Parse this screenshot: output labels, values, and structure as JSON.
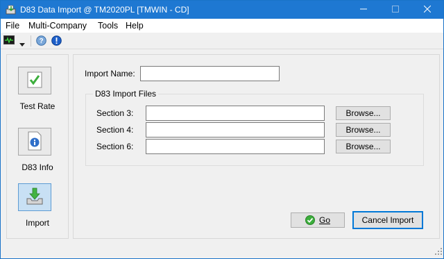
{
  "window": {
    "title": "D83 Data Import @ TM2020PL [TMWIN - CD]",
    "title_bar_color": "#1e78d2"
  },
  "menu": {
    "items": [
      "File",
      "Multi-Company",
      "Tools",
      "Help"
    ]
  },
  "toolbar": {
    "icons": [
      "monitor-icon",
      "dropdown-arrow-icon",
      "help-icon",
      "info-alert-icon"
    ]
  },
  "sidebar": {
    "items": [
      {
        "label": "Test Rate",
        "icon": "checkmark-icon"
      },
      {
        "label": "D83 Info",
        "icon": "info-document-icon"
      },
      {
        "label": "Import",
        "icon": "import-tray-icon",
        "active": true
      }
    ]
  },
  "form": {
    "import_name_label": "Import Name:",
    "import_name_value": "",
    "group_title": "D83 Import Files",
    "files": [
      {
        "label": "Section 3:",
        "value": "",
        "button": "Browse..."
      },
      {
        "label": "Section 4:",
        "value": "",
        "button": "Browse..."
      },
      {
        "label": "Section 6:",
        "value": "",
        "button": "Browse..."
      }
    ],
    "go_label": "Go",
    "cancel_label": "Cancel Import"
  },
  "colors": {
    "accent": "#0078d7",
    "active_sidebar": "#c8e0f4",
    "go_icon": "#3cae3c"
  }
}
